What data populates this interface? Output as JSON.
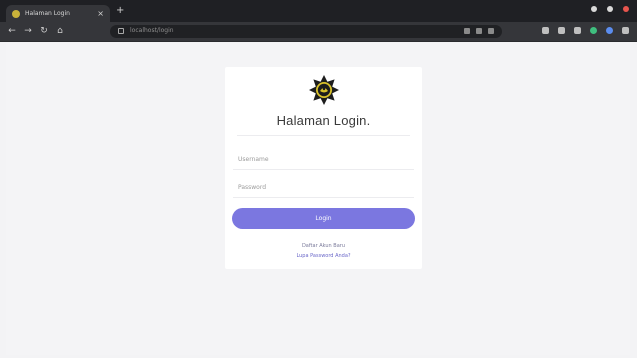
{
  "browser": {
    "tab_title": "Halaman Login",
    "omnibox_url": "localhost/login",
    "accent_close": "#e8554e"
  },
  "card": {
    "title": "Halaman Login.",
    "username_placeholder": "Username",
    "password_placeholder": "Password",
    "login_label": "Login",
    "register_link": "Daftar Akun Baru",
    "forgot_link": "Lupa Password Anda?"
  },
  "colors": {
    "button": "#7b77e0",
    "page_bg": "#f4f4f6",
    "logo_dark": "#1d1d1d",
    "logo_gold": "#d9c22b"
  }
}
